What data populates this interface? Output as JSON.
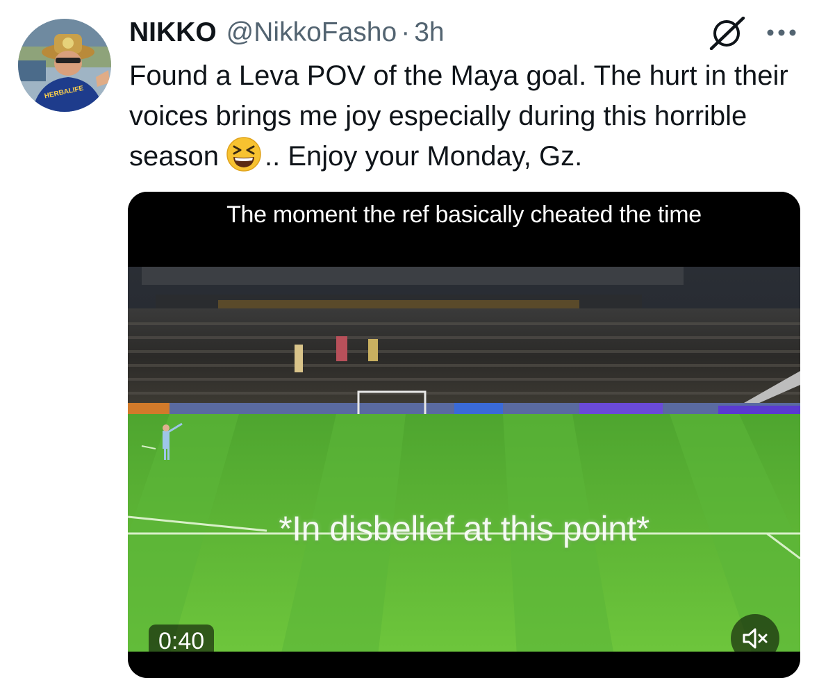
{
  "tweet": {
    "display_name": "NIKKO",
    "handle": "@NikkoFasho",
    "separator": "·",
    "time": "3h",
    "text_part1": "Found a Leva POV of the Maya goal. The hurt in their voices brings me joy especially during this horrible season",
    "emoji": "grinning-squinting-face",
    "text_part2": ".. Enjoy your Monday, Gz."
  },
  "media": {
    "caption": "The moment the ref basically cheated the time",
    "overlay_text": "*In disbelief at this point*",
    "duration": "0:40",
    "mute_icon": "volume-muted-icon"
  },
  "colors": {
    "text": "#0f1419",
    "secondary": "#536471",
    "pitch": "#5fba3a"
  }
}
